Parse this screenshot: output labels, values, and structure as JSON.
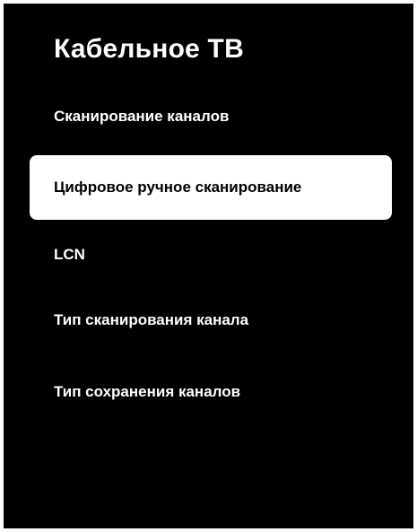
{
  "colors": {
    "background": "#000000",
    "text": "#ffffff",
    "selected_background": "#ffffff",
    "selected_text": "#000000"
  },
  "screen": {
    "title": "Кабельное ТВ",
    "menu": [
      {
        "label": "Сканирование каналов",
        "selected": false
      },
      {
        "label": "Цифровое ручное сканирование",
        "selected": true
      },
      {
        "label": "LCN",
        "selected": false
      },
      {
        "label": "Тип сканирования канала",
        "selected": false
      },
      {
        "label": "Тип сохранения каналов",
        "selected": false
      }
    ]
  }
}
